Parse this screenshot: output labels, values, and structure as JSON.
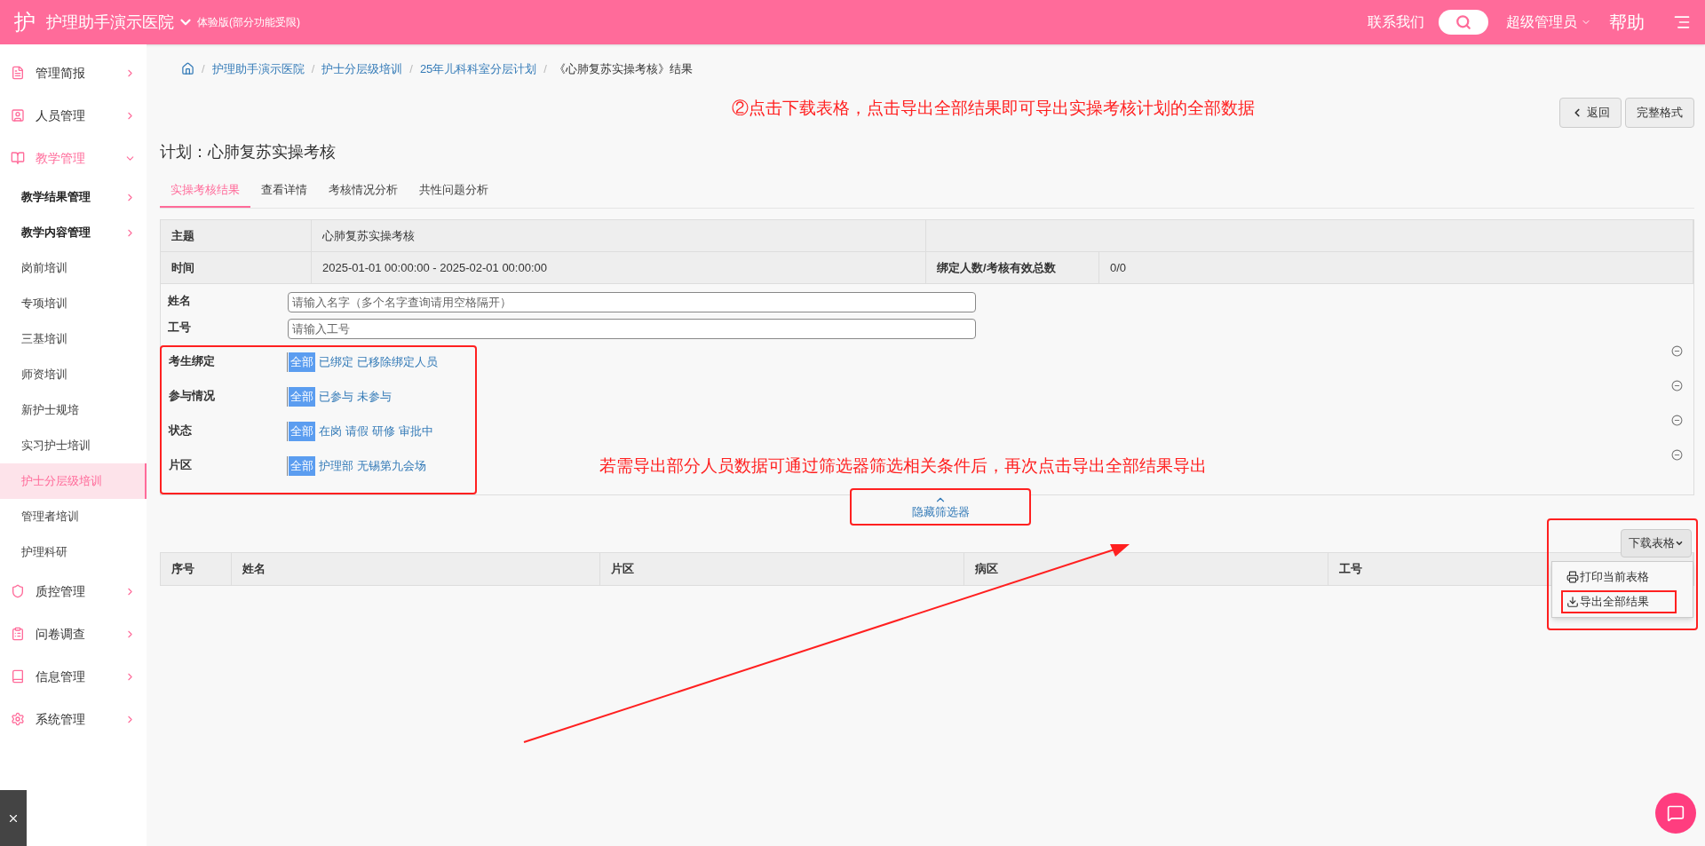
{
  "header": {
    "logo": "护",
    "hospital": "护理助手演示医院",
    "edition": "体验版(部分功能受限)",
    "contact": "联系我们",
    "user": "超级管理员",
    "help": "帮助"
  },
  "sidebar": [
    {
      "label": "管理简报",
      "expanded": false
    },
    {
      "label": "人员管理",
      "expanded": false
    },
    {
      "label": "教学管理",
      "expanded": true,
      "children": [
        {
          "label": "教学结果管理",
          "kind": "group",
          "selected": false
        },
        {
          "label": "教学内容管理",
          "kind": "group",
          "selected": false
        },
        {
          "label": "岗前培训",
          "kind": "page",
          "selected": false
        },
        {
          "label": "专项培训",
          "kind": "page",
          "selected": false
        },
        {
          "label": "三基培训",
          "kind": "page",
          "selected": false
        },
        {
          "label": "师资培训",
          "kind": "page",
          "selected": false
        },
        {
          "label": "新护士规培",
          "kind": "page",
          "selected": false
        },
        {
          "label": "实习护士培训",
          "kind": "page",
          "selected": false
        },
        {
          "label": "护士分层级培训",
          "kind": "page",
          "selected": true
        },
        {
          "label": "管理者培训",
          "kind": "page",
          "selected": false
        },
        {
          "label": "护理科研",
          "kind": "page",
          "selected": false
        }
      ]
    },
    {
      "label": "质控管理",
      "expanded": false
    },
    {
      "label": "问卷调查",
      "expanded": false
    },
    {
      "label": "信息管理",
      "expanded": false
    },
    {
      "label": "系统管理",
      "expanded": false
    }
  ],
  "breadcrumb": [
    {
      "sep": "/",
      "label": "护理助手演示医院"
    },
    {
      "sep": "/",
      "label": "护士分层级培训"
    },
    {
      "sep": "/",
      "label": "25年儿科科室分层计划"
    },
    {
      "sep": "/",
      "label": "《心肺复苏实操考核》结果"
    }
  ],
  "annotations": [
    "②点击下载表格，点击导出全部结果即可导出实操考核计划的全部数据",
    "若需导出部分人员数据可通过筛选器筛选相关条件后，再次点击导出全部结果导出"
  ],
  "actions": [
    "返回",
    "完整格式"
  ],
  "plan_title": "计划：心肺复苏实操考核",
  "tabs": [
    {
      "label": "实操考核结果",
      "selected": true
    },
    {
      "label": "查看详情",
      "selected": false
    },
    {
      "label": "考核情况分析",
      "selected": false
    },
    {
      "label": "共性问题分析",
      "selected": false
    }
  ],
  "info": [
    [
      "主题",
      "心肺复苏实操考核"
    ],
    [
      "时间",
      "2025-01-01 00:00:00 - 2025-02-01 00:00:00",
      "绑定人数/考核有效总数",
      "0/0"
    ]
  ],
  "fields": [
    {
      "label": "姓名",
      "placeholder": "请输入名字（多个名字查询请用空格隔开）"
    },
    {
      "label": "工号",
      "placeholder": "请输入工号"
    }
  ],
  "filters": [
    {
      "label": "考生绑定",
      "options": [
        {
          "label": "全部",
          "selected": true
        },
        {
          "label": "已绑定",
          "selected": false
        },
        {
          "label": "已移除绑定人员",
          "selected": false
        }
      ]
    },
    {
      "label": "参与情况",
      "options": [
        {
          "label": "全部",
          "selected": true
        },
        {
          "label": "已参与",
          "selected": false
        },
        {
          "label": "未参与",
          "selected": false
        }
      ]
    },
    {
      "label": "状态",
      "options": [
        {
          "label": "全部",
          "selected": true
        },
        {
          "label": "在岗",
          "selected": false
        },
        {
          "label": "请假",
          "selected": false
        },
        {
          "label": "研修",
          "selected": false
        },
        {
          "label": "审批中",
          "selected": false
        }
      ]
    },
    {
      "label": "片区",
      "options": [
        {
          "label": "全部",
          "selected": true
        },
        {
          "label": "护理部",
          "selected": false
        },
        {
          "label": "无锡第九会场",
          "selected": false
        }
      ]
    }
  ],
  "hide_filter": "隐藏筛选器",
  "download": {
    "label": "下载表格",
    "menu": [
      "打印当前表格",
      "导出全部结果"
    ]
  },
  "results_columns": [
    "序号",
    "姓名",
    "片区",
    "病区",
    "工号"
  ]
}
